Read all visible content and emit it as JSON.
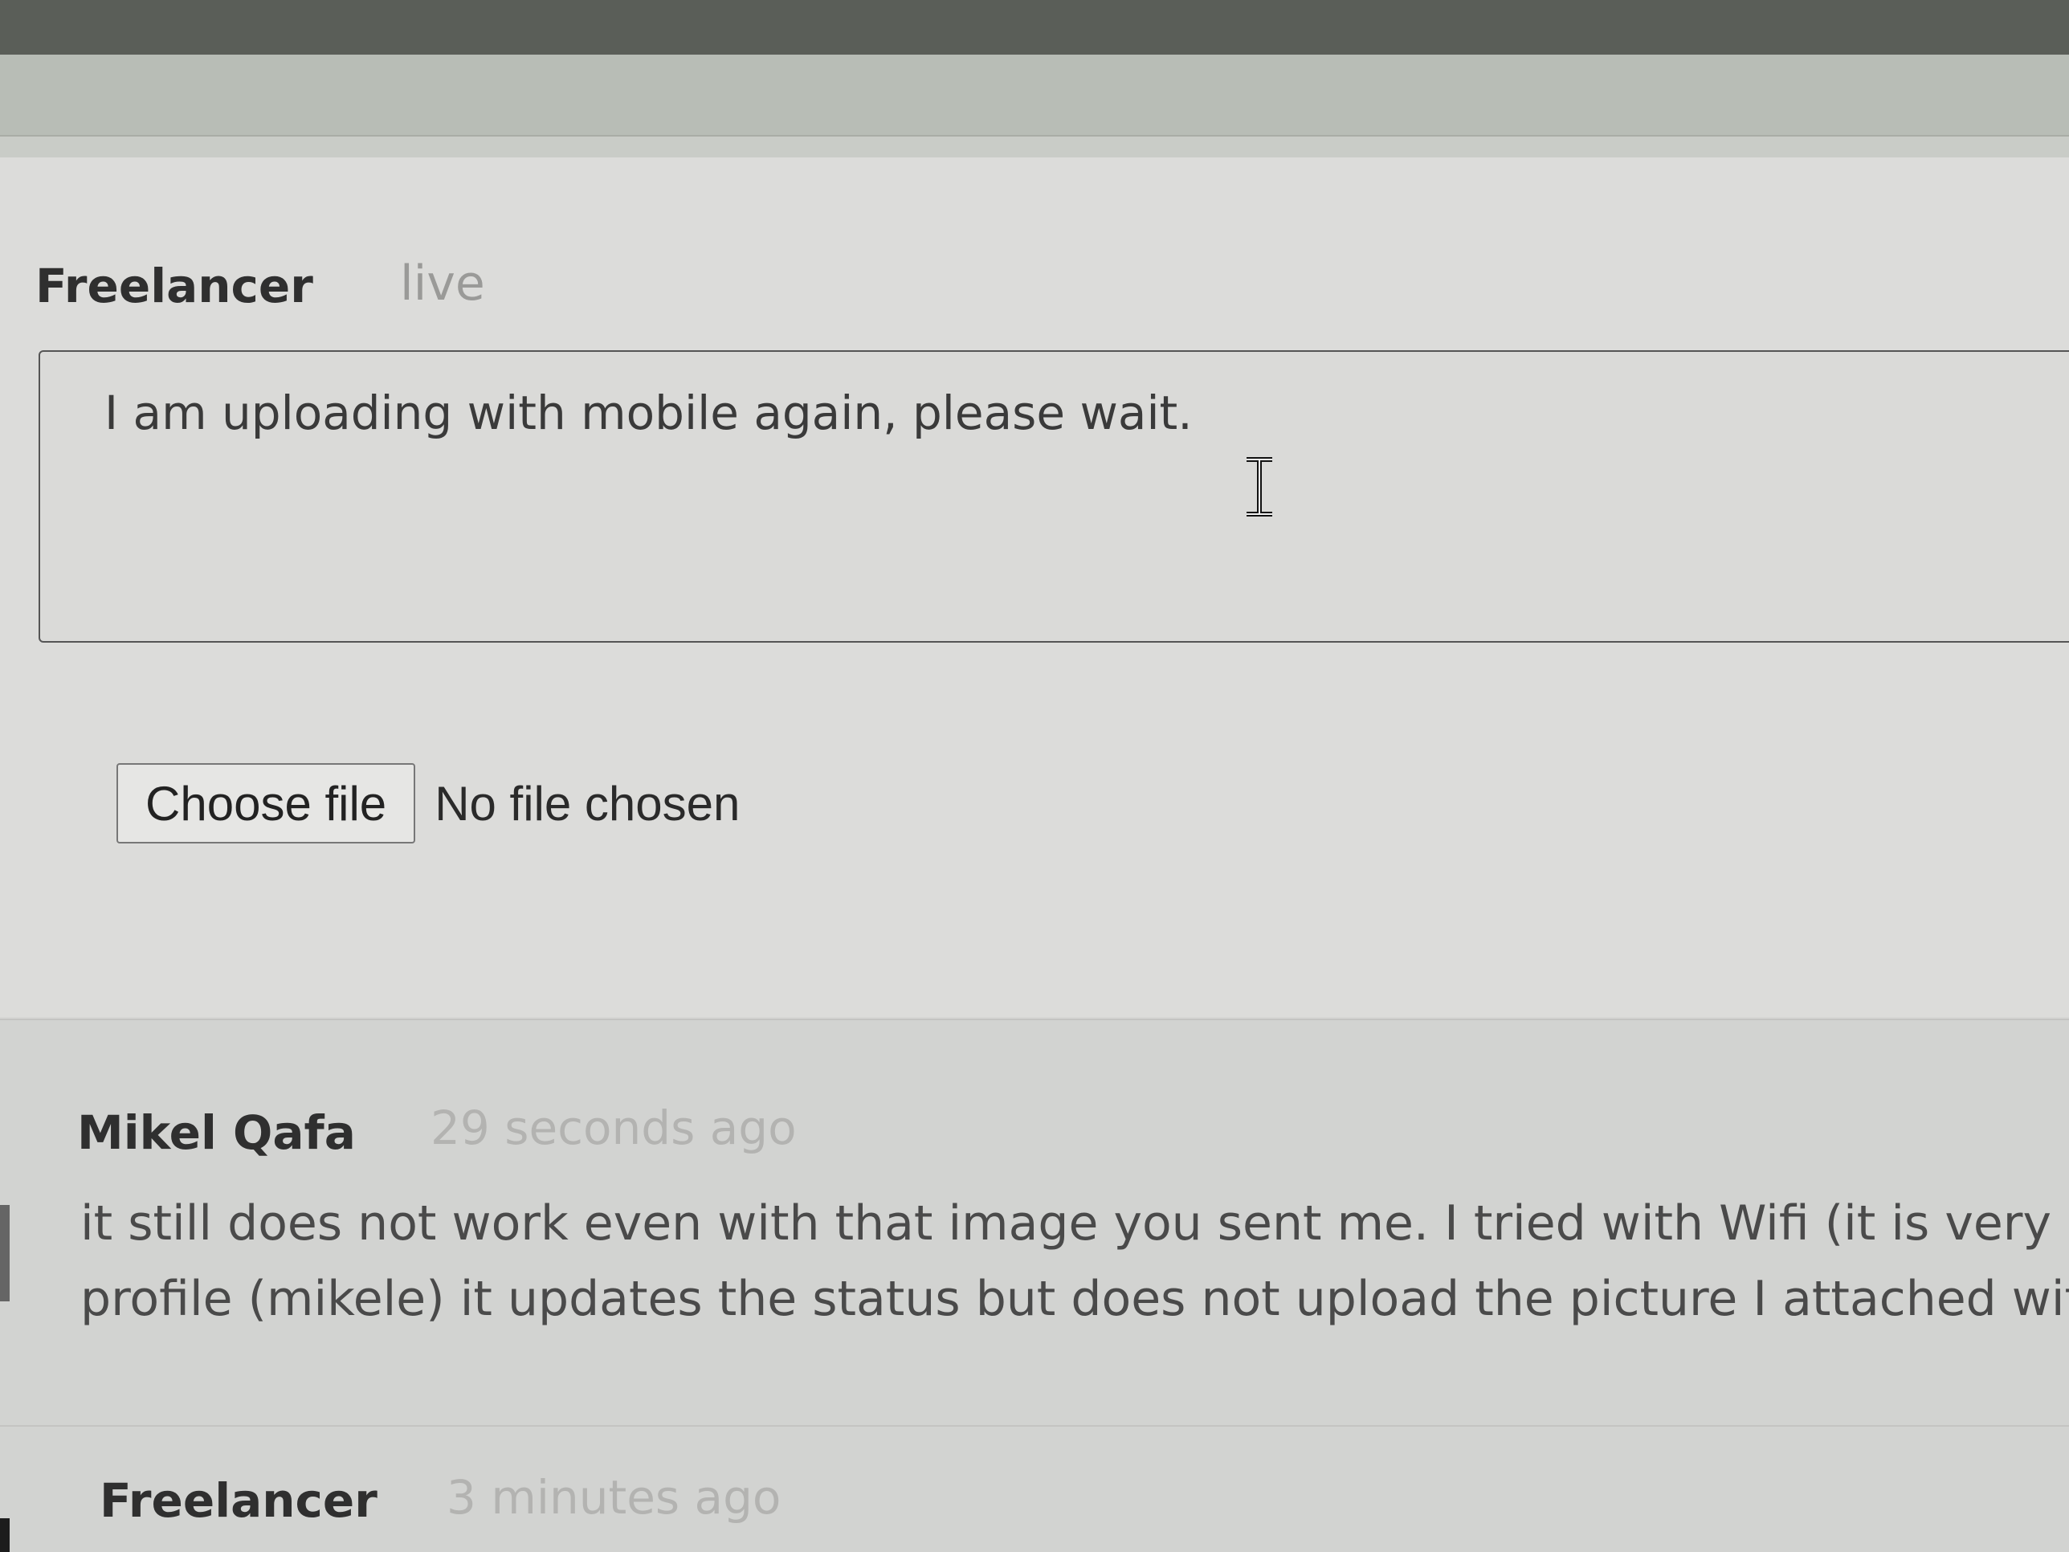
{
  "composer": {
    "author": "Freelancer",
    "status": "live",
    "message": "I am uploading with mobile again, please wait.",
    "file_button_label": "Choose file",
    "file_status": "No file chosen"
  },
  "comments": [
    {
      "author": "Mikel Qafa",
      "time": "29 seconds ago",
      "line1": "it still does not work even with that image you sent me. I tried with Wifi (it is very go",
      "line2": "profile (mikele) it updates the status but does not upload the picture I attached with"
    },
    {
      "author": "Freelancer",
      "time": "3 minutes ago"
    }
  ]
}
